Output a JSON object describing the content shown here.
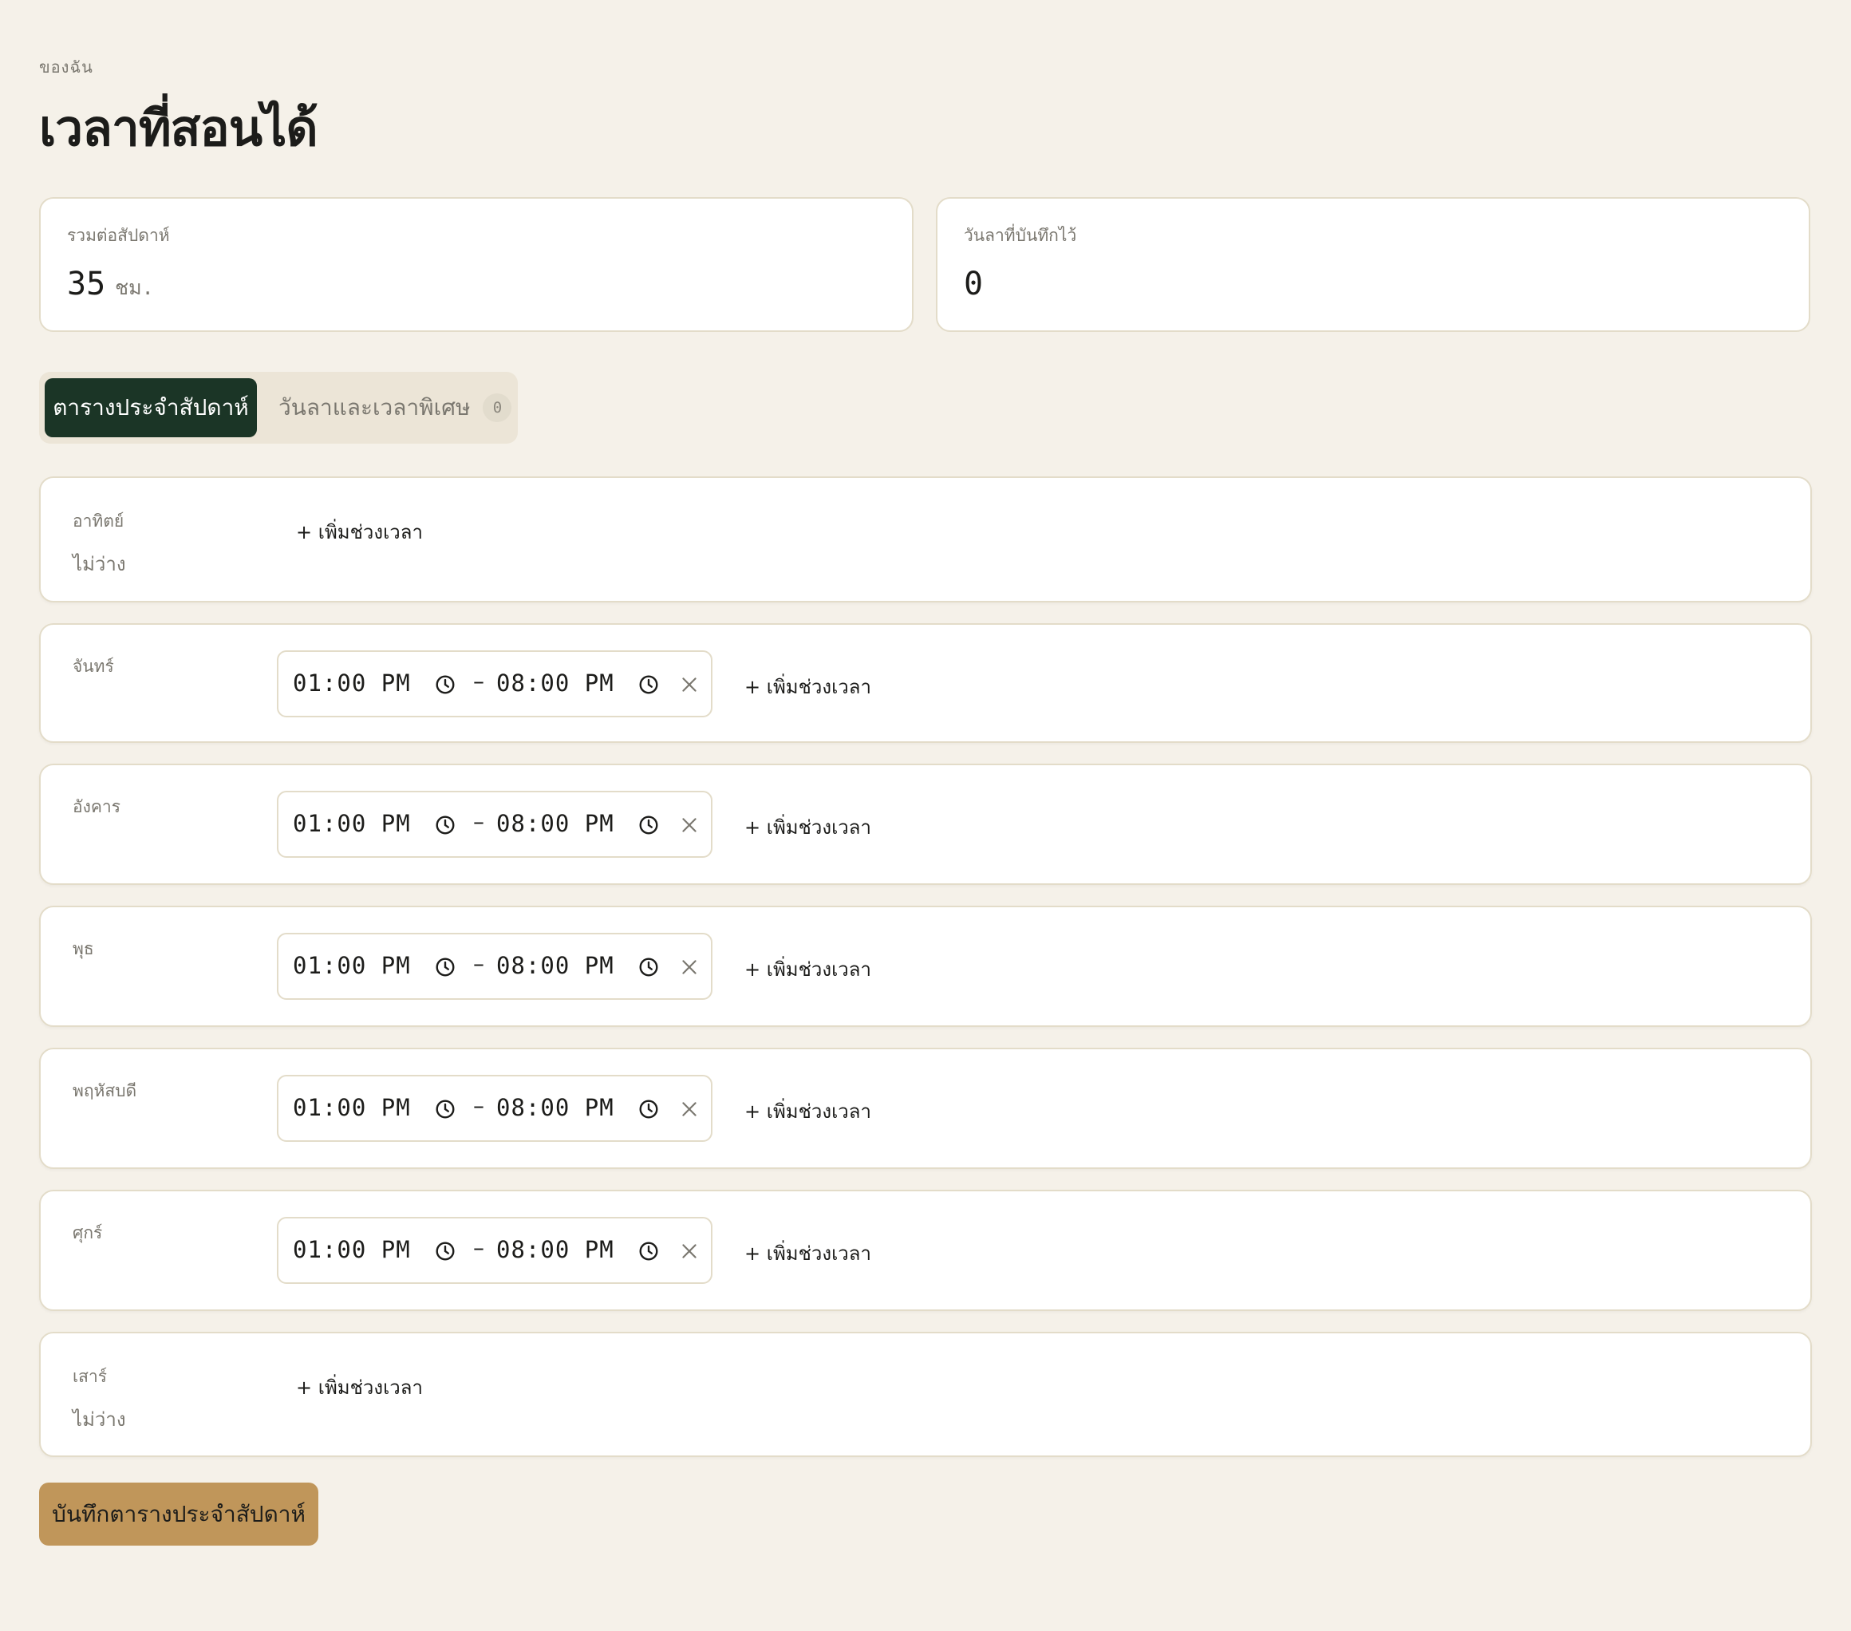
{
  "header": {
    "eyebrow": "ของฉัน",
    "title": "เวลาที่สอนได้"
  },
  "stats": {
    "weekly_total_label": "รวมต่อสัปดาห์",
    "weekly_total_value": "35",
    "weekly_total_unit": "ชม.",
    "leave_days_label": "วันลาที่บันทึกไว้",
    "leave_days_value": "0"
  },
  "tabs": {
    "weekly_label": "ตารางประจำสัปดาห์",
    "special_label": "วันลาและเวลาพิเศษ",
    "special_count": "0"
  },
  "days": [
    {
      "name": "อาทิตย์",
      "status": "ไม่ว่าง"
    },
    {
      "name": "จันทร์",
      "start": "01:00 PM",
      "end": "08:00 PM"
    },
    {
      "name": "อังคาร",
      "start": "01:00 PM",
      "end": "08:00 PM"
    },
    {
      "name": "พุธ",
      "start": "01:00 PM",
      "end": "08:00 PM"
    },
    {
      "name": "พฤหัสบดี",
      "start": "01:00 PM",
      "end": "08:00 PM"
    },
    {
      "name": "ศุกร์",
      "start": "01:00 PM",
      "end": "08:00 PM"
    },
    {
      "name": "เสาร์",
      "status": "ไม่ว่าง"
    }
  ],
  "actions": {
    "add_slot_label": "+ เพิ่มช่วงเวลา",
    "range_separator": "–",
    "save_label": "บันทึกตารางประจำสัปดาห์"
  },
  "colors": {
    "background": "#f5f1e9",
    "card_border": "#e3dcc9",
    "tab_active": "#1b3526",
    "save_button": "#c0965a"
  }
}
